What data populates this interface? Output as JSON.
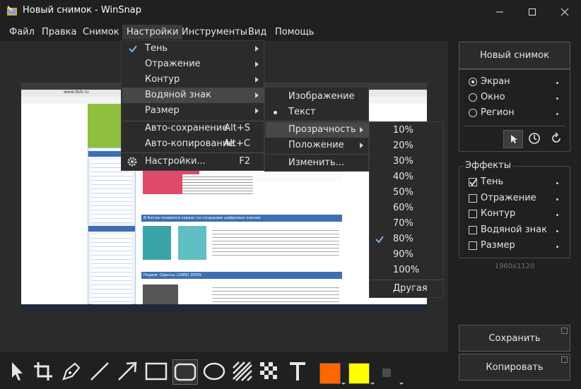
{
  "window": {
    "title": "Новый снимок - WinSnap"
  },
  "menu": [
    "Файл",
    "Правка",
    "Снимок",
    "Настройки",
    "Инструменты",
    "Вид",
    "Помощь"
  ],
  "settings_menu": {
    "items": [
      {
        "label": "Тень",
        "checked": true,
        "submenu": true
      },
      {
        "label": "Отражение",
        "submenu": true
      },
      {
        "label": "Контур",
        "submenu": true
      },
      {
        "label": "Водяной знак",
        "submenu": true,
        "highlighted": true
      },
      {
        "label": "Размер",
        "submenu": true
      },
      {
        "label": "Авто-сохранение",
        "shortcut": "Alt+S"
      },
      {
        "label": "Авто-копирование",
        "shortcut": "Alt+C"
      },
      {
        "label": "Настройки...",
        "shortcut": "F2"
      }
    ]
  },
  "watermark_menu": {
    "items": [
      {
        "label": "Изображение"
      },
      {
        "label": "Текст",
        "selected": true
      },
      {
        "label": "Прозрачность",
        "submenu": true,
        "highlighted": true
      },
      {
        "label": "Положение",
        "submenu": true
      },
      {
        "label": "Изменить..."
      }
    ]
  },
  "transparency_menu": {
    "items": [
      "10%",
      "20%",
      "30%",
      "40%",
      "50%",
      "60%",
      "70%",
      "80%",
      "90%",
      "100%"
    ],
    "checked": "80%",
    "other": "Другая"
  },
  "right_panel": {
    "new_snapshot": "Новый снимок",
    "capture_modes": [
      "Экран",
      "Окно",
      "Регион"
    ],
    "capture_selected": "Экран",
    "effects_title": "Эффекты",
    "effects": [
      {
        "label": "Тень",
        "checked": true
      },
      {
        "label": "Отражение",
        "checked": false
      },
      {
        "label": "Контур",
        "checked": false
      },
      {
        "label": "Водяной знак",
        "checked": false
      },
      {
        "label": "Размер",
        "checked": false
      }
    ],
    "dimensions": "1960x1120",
    "save": "Сохранить",
    "copy": "Копировать"
  },
  "toolbar": {
    "tools": [
      "pointer-icon",
      "crop-icon",
      "pen-icon",
      "line-icon",
      "arrow-icon",
      "rectangle-icon",
      "rounded-rectangle-icon",
      "ellipse-icon",
      "hatch-icon",
      "pixelate-icon",
      "text-icon"
    ],
    "colors": {
      "primary": "#ff6600",
      "secondary": "#ffff00"
    }
  },
  "screenshot_preview": {
    "address": "www.dub.ru",
    "heading_1": "В Китае появился сервис по созданию цифровых клонов",
    "heading_2": "Подвиг Одессы (1985) DVD5"
  }
}
